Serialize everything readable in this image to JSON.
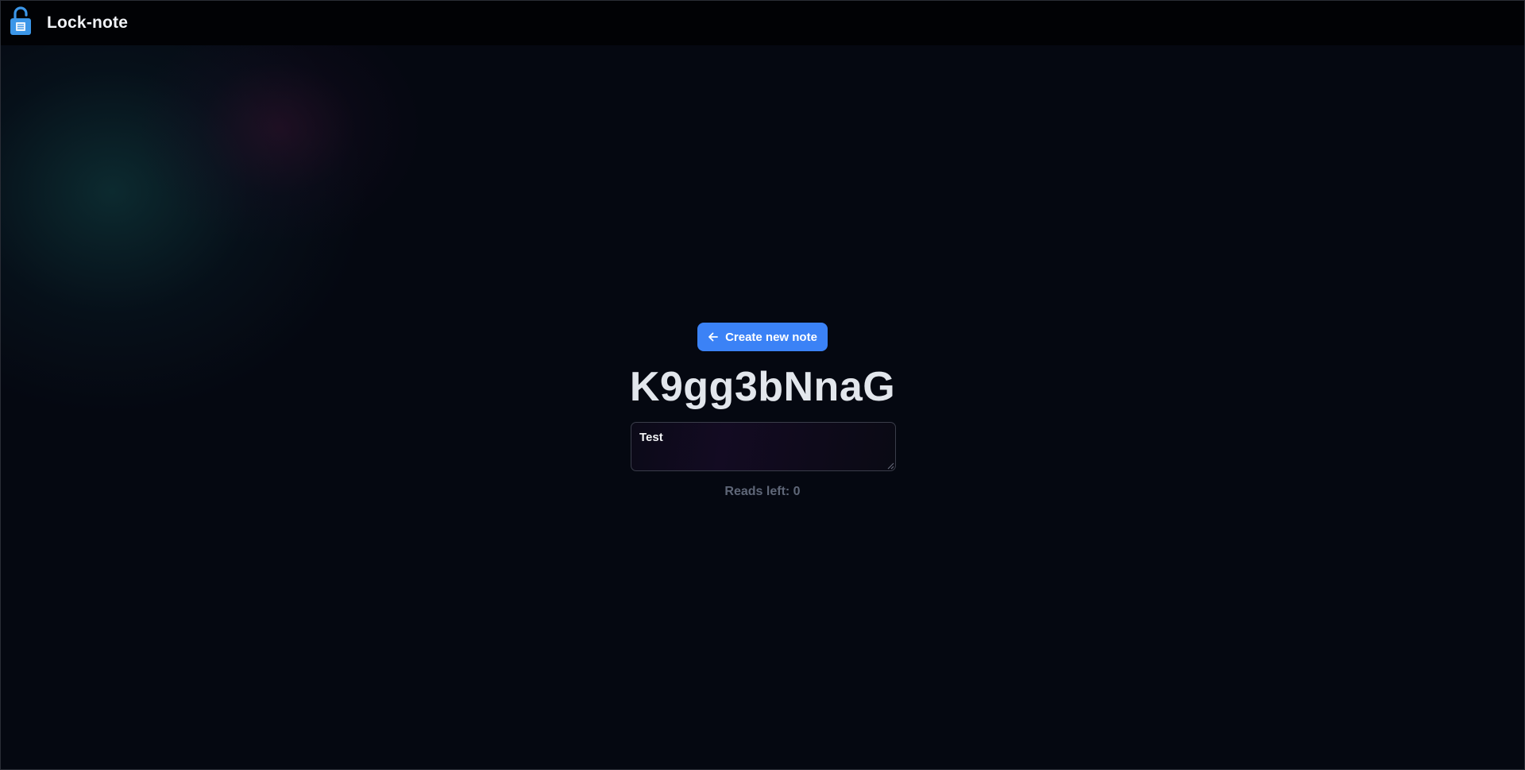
{
  "header": {
    "brand": "Lock-note",
    "logo_icon": "lock-note-icon"
  },
  "main": {
    "create_button_label": "Create new note",
    "create_button_icon": "arrow-left-icon",
    "note_id": "K9gg3bNnaG",
    "note_text": "Test",
    "reads_left": "Reads left: 0"
  },
  "colors": {
    "accent": "#3b82f6",
    "background": "#050811",
    "topbar": "#010205",
    "muted_text": "#5f6778"
  }
}
